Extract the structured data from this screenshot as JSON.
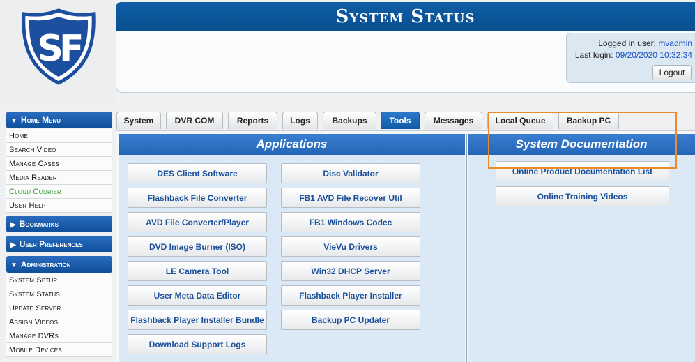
{
  "header": {
    "title": "System Status",
    "logged_in_label": "Logged in user:",
    "logged_in_user": "mvadmin",
    "last_login_label": "Last login:",
    "last_login_value": "09/20/2020 10:32:34",
    "logout_label": "Logout"
  },
  "logo": {
    "icon": "sf-shield-logo",
    "letters": "SF"
  },
  "sidebar": {
    "home_menu": "Home Menu",
    "home_items": [
      "Home",
      "Search Video",
      "Manage Cases",
      "Media Reader",
      "Cloud Courier",
      "User Help"
    ],
    "bookmarks": "Bookmarks",
    "user_preferences": "User Preferences",
    "administration": "Administration",
    "admin_items": [
      "System Setup",
      "System Status",
      "Update Server",
      "Assign Videos",
      "Manage DVRs",
      "Mobile Devices"
    ]
  },
  "tabs": [
    "System",
    "DVR COM",
    "Reports",
    "Logs",
    "Backups",
    "Tools",
    "Messages",
    "Local Queue",
    "Backup PC"
  ],
  "active_tab": "Tools",
  "applications": {
    "heading": "Applications",
    "left": [
      "DES Client Software",
      "Flashback File Converter",
      "AVD File Converter/Player",
      "DVD Image Burner (ISO)",
      "LE Camera Tool",
      "User Meta Data Editor",
      "Flashback Player Installer Bundle",
      "Download Support Logs"
    ],
    "right": [
      "Disc Validator",
      "FB1 AVD File Recover Util",
      "FB1 Windows Codec",
      "VieVu Drivers",
      "Win32 DHCP Server",
      "Flashback Player Installer",
      "Backup PC Updater"
    ]
  },
  "documentation": {
    "heading": "System Documentation",
    "buttons": [
      "Online Product Documentation List",
      "Online Training Videos"
    ]
  },
  "colors": {
    "header_blue": "#0e5da5",
    "highlight_orange": "#ec8a2e",
    "link_blue": "#1b4fc8",
    "green_item": "#2d9b2d"
  }
}
